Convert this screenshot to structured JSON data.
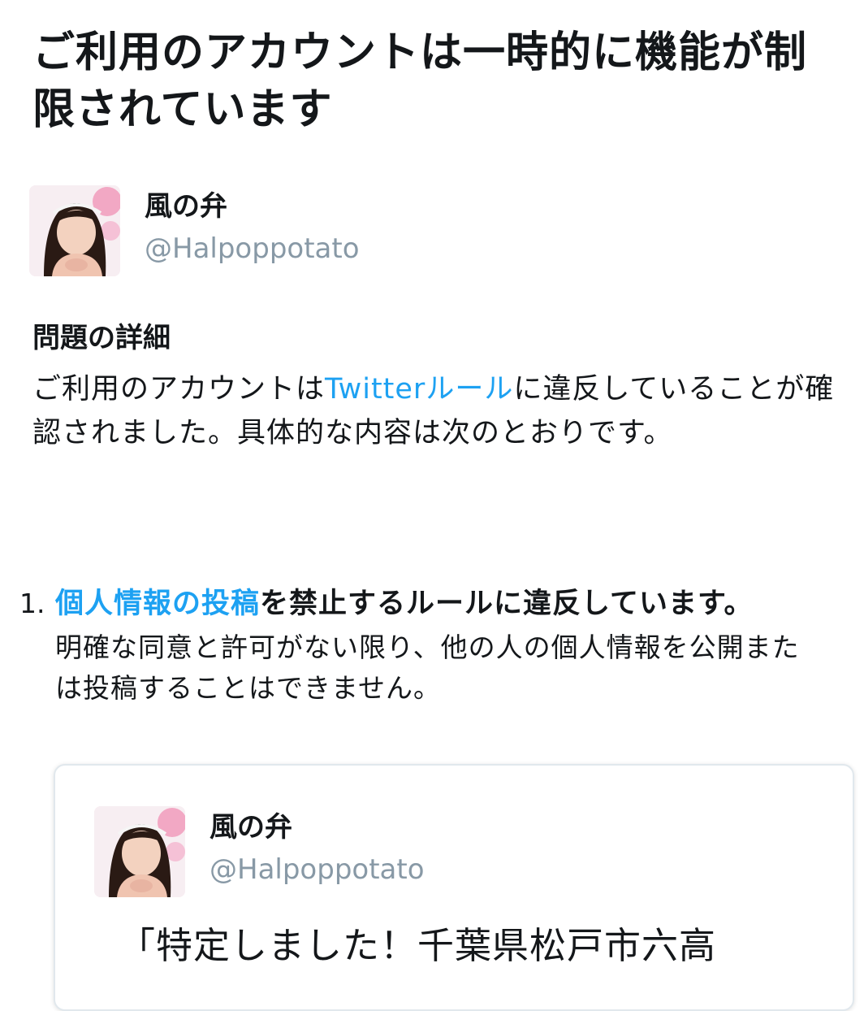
{
  "header": {
    "title": "ご利用のアカウントは一時的に機能が制限されています"
  },
  "account": {
    "display_name": "風の弁",
    "handle": "@Halpoppotato"
  },
  "details": {
    "heading": "問題の詳細",
    "text_before_link": "ご利用のアカウントは",
    "link_label": "Twitterルール",
    "text_after_link": "に違反していることが確認されました。具体的な内容は次のとおりです。"
  },
  "violations": [
    {
      "number": "1.",
      "link_label": "個人情報の投稿",
      "title_rest": "を禁止するルールに違反しています。",
      "description": "明確な同意と許可がない限り、他の人の個人情報を公開または投稿することはできません。"
    }
  ],
  "tweet": {
    "display_name": "風の弁",
    "handle": "@Halpoppotato",
    "text": "「特定しました！千葉県松戸市六高"
  },
  "colors": {
    "link": "#1da1f2",
    "text": "#14171a",
    "muted": "#8899a6",
    "card_border": "#e1e8ed"
  }
}
